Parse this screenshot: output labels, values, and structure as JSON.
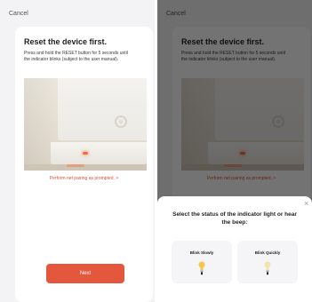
{
  "screen": {
    "cancel_label": "Cancel",
    "title": "Reset the device first.",
    "description": "Press and hold the RESET button for 5 seconds until the indicator blinks (subject to the user manual).",
    "link_text": "Perform net pairing as prompted. >",
    "next_label": "Next"
  },
  "sheet": {
    "close_symbol": "×",
    "question": "Select the status of the indicator light or hear the beep:",
    "options": [
      {
        "label": "Blink Slowly",
        "icon": "bulb-lit-icon"
      },
      {
        "label": "Blink Quickly",
        "icon": "bulb-dim-icon"
      }
    ]
  },
  "colors": {
    "accent": "#e5573d",
    "link": "#d8543c",
    "background": "#f3f3f5",
    "bulb_lit": "#f6c54a",
    "bulb_dim": "#f3e3ad"
  }
}
